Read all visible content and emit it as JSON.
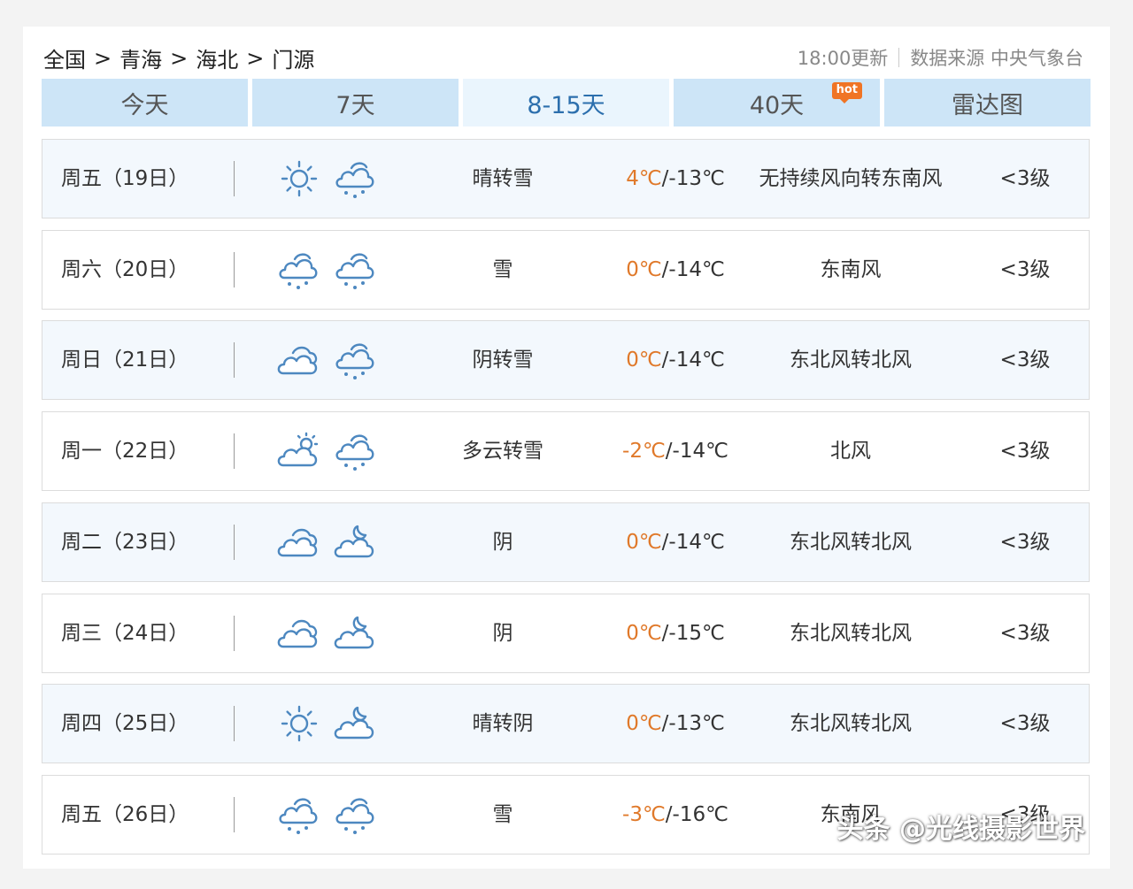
{
  "breadcrumb": {
    "items": [
      "全国",
      "青海",
      "海北",
      "门源"
    ],
    "separator": ">"
  },
  "meta": {
    "updated": "18:00更新",
    "source": "数据来源 中央气象台"
  },
  "tabs": [
    {
      "label": "今天",
      "active": false
    },
    {
      "label": "7天",
      "active": false
    },
    {
      "label": "8-15天",
      "active": true
    },
    {
      "label": "40天",
      "active": false,
      "badge": "hot"
    },
    {
      "label": "雷达图",
      "active": false
    }
  ],
  "forecast": [
    {
      "day": "周五（19日）",
      "icon_day": "sun-icon",
      "icon_night": "snow-icon",
      "desc": "晴转雪",
      "high": "4℃",
      "low": "/-13℃",
      "wind": "无持续风向转东南风",
      "level": "<3级"
    },
    {
      "day": "周六（20日）",
      "icon_day": "snow-icon",
      "icon_night": "snow-icon",
      "desc": "雪",
      "high": "0℃",
      "low": "/-14℃",
      "wind": "东南风",
      "level": "<3级"
    },
    {
      "day": "周日（21日）",
      "icon_day": "overcast-icon",
      "icon_night": "snow-icon",
      "desc": "阴转雪",
      "high": "0℃",
      "low": "/-14℃",
      "wind": "东北风转北风",
      "level": "<3级"
    },
    {
      "day": "周一（22日）",
      "icon_day": "partly-cloudy-icon",
      "icon_night": "snow-icon",
      "desc": "多云转雪",
      "high": "-2℃",
      "low": "/-14℃",
      "wind": "北风",
      "level": "<3级"
    },
    {
      "day": "周二（23日）",
      "icon_day": "overcast-icon",
      "icon_night": "cloudy-night-icon",
      "desc": "阴",
      "high": "0℃",
      "low": "/-14℃",
      "wind": "东北风转北风",
      "level": "<3级"
    },
    {
      "day": "周三（24日）",
      "icon_day": "overcast-icon",
      "icon_night": "cloudy-night-icon",
      "desc": "阴",
      "high": "0℃",
      "low": "/-15℃",
      "wind": "东北风转北风",
      "level": "<3级"
    },
    {
      "day": "周四（25日）",
      "icon_day": "sun-icon",
      "icon_night": "cloudy-night-icon",
      "desc": "晴转阴",
      "high": "0℃",
      "low": "/-13℃",
      "wind": "东北风转北风",
      "level": "<3级"
    },
    {
      "day": "周五（26日）",
      "icon_day": "snow-icon",
      "icon_night": "snow-icon",
      "desc": "雪",
      "high": "-3℃",
      "low": "/-16℃",
      "wind": "东南风",
      "level": "<3级"
    }
  ],
  "watermark": "头条 @光线摄影世界",
  "colors": {
    "tab_bg": "#cde5f7",
    "tab_active_bg": "#eaf5fd",
    "tab_active_text": "#2c6fad",
    "high_temp": "#e0792a",
    "icon_blue": "#4d88c0",
    "hot_badge": "#f07424"
  }
}
